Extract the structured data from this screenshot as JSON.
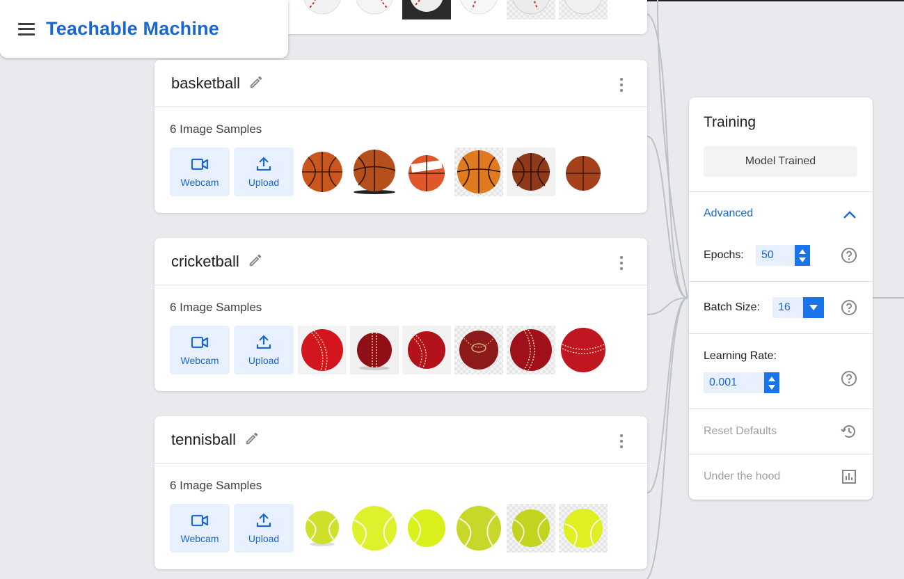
{
  "app": {
    "title": "Teachable Machine"
  },
  "classes": [
    {
      "name": "basketball",
      "samples_label": "6 Image Samples",
      "webcam_label": "Webcam",
      "upload_label": "Upload"
    },
    {
      "name": "cricketball",
      "samples_label": "6 Image Samples",
      "webcam_label": "Webcam",
      "upload_label": "Upload"
    },
    {
      "name": "tennisball",
      "samples_label": "6 Image Samples",
      "webcam_label": "Webcam",
      "upload_label": "Upload"
    }
  ],
  "training": {
    "title": "Training",
    "train_button": "Model Trained",
    "advanced_label": "Advanced",
    "epochs_label": "Epochs:",
    "epochs_value": "50",
    "batch_size_label": "Batch Size:",
    "batch_size_value": "16",
    "learning_rate_label": "Learning Rate:",
    "learning_rate_value": "0.001",
    "reset_label": "Reset Defaults",
    "under_hood_label": "Under the hood"
  },
  "colors": {
    "accent": "#1967d2",
    "basketball": "#c9561f",
    "cricketball": "#b3121b",
    "tennisball": "#d4e52a"
  }
}
